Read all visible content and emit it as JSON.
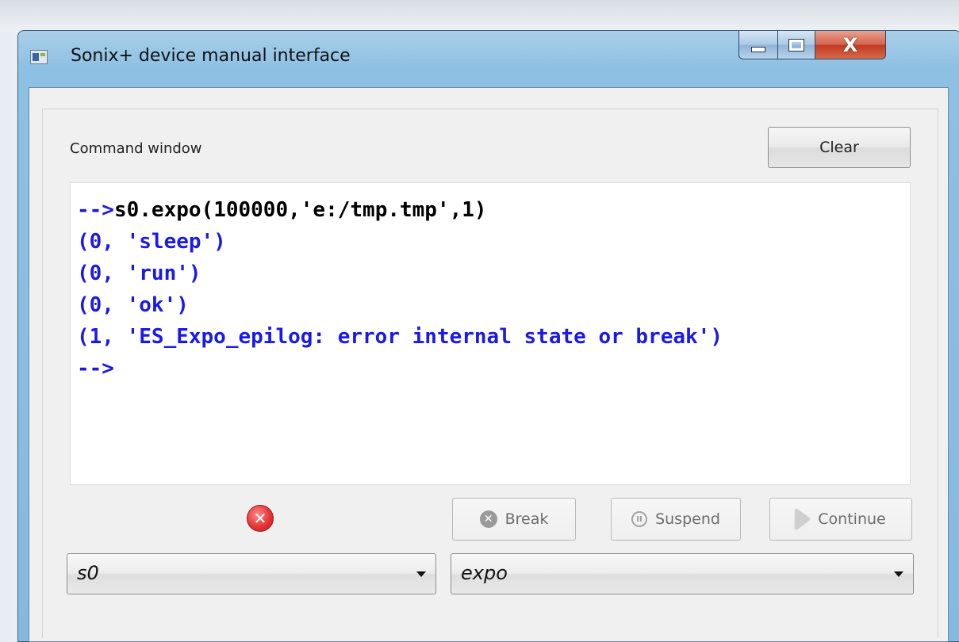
{
  "window": {
    "title": "Sonix+ device manual interface",
    "close_glyph": "X"
  },
  "command_window": {
    "label": "Command window",
    "clear_label": "Clear",
    "prompt": "-->",
    "command": "s0.expo(100000,'e:/tmp.tmp',1)",
    "output_lines": [
      "(0, 'sleep')",
      "(0, 'run')",
      "(0, 'ok')",
      "(1, 'ES_Expo_epilog: error internal state or break')"
    ],
    "final_prompt": "-->"
  },
  "controls": {
    "error_icon": "error-icon",
    "break_label": "Break",
    "suspend_label": "Suspend",
    "continue_label": "Continue"
  },
  "selectors": {
    "object_value": "s0",
    "method_value": "expo"
  },
  "colors": {
    "output_blue": "#1a1ae6",
    "error_red": "#e53535"
  }
}
